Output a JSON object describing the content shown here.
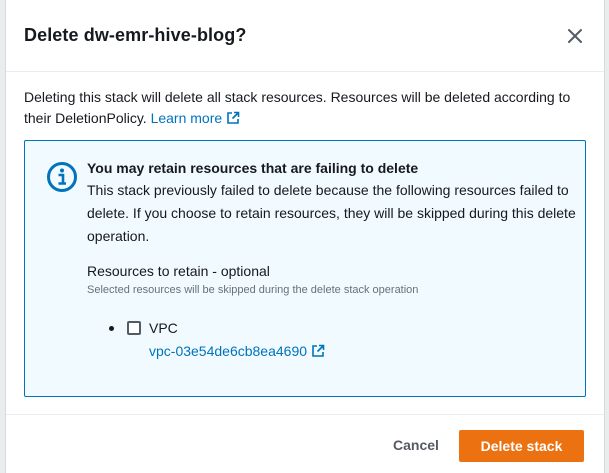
{
  "dialog": {
    "title": "Delete dw-emr-hive-blog?",
    "intro_text": "Deleting this stack will delete all stack resources. Resources will be deleted according to their DeletionPolicy.",
    "learn_more_label": "Learn more"
  },
  "alert": {
    "title": "You may retain resources that are failing to delete",
    "text": "This stack previously failed to delete because the following resources failed to delete. If you choose to retain resources, they will be skipped during this delete operation."
  },
  "resources": {
    "label": "Resources to retain - optional",
    "description": "Selected resources will be skipped during the delete stack operation",
    "items": [
      {
        "name": "VPC",
        "physical_id": "vpc-03e54de6cb8ea4690",
        "checked": false
      }
    ]
  },
  "footer": {
    "cancel_label": "Cancel",
    "delete_label": "Delete stack"
  },
  "colors": {
    "link": "#0073bb",
    "primary_button": "#ec7211",
    "alert_background": "#f1faff",
    "alert_border": "#0073bb"
  },
  "icons": [
    "close-icon",
    "external-link-icon",
    "info-icon"
  ]
}
